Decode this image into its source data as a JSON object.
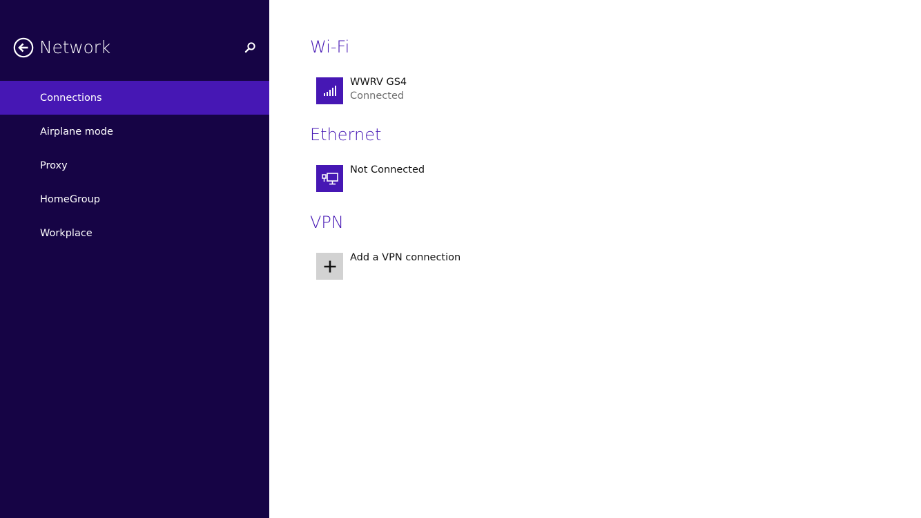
{
  "sidebar": {
    "title": "Network",
    "back_icon": "back-arrow-circle-icon",
    "search_icon": "search-icon",
    "items": [
      {
        "label": "Connections",
        "active": true
      },
      {
        "label": "Airplane mode",
        "active": false
      },
      {
        "label": "Proxy",
        "active": false
      },
      {
        "label": "HomeGroup",
        "active": false
      },
      {
        "label": "Workplace",
        "active": false
      }
    ]
  },
  "main": {
    "wifi": {
      "title": "Wi-Fi",
      "network": {
        "name": "WWRV GS4",
        "status": "Connected",
        "icon": "wifi-signal-icon"
      }
    },
    "ethernet": {
      "title": "Ethernet",
      "network": {
        "name": "Not Connected",
        "icon": "ethernet-icon"
      }
    },
    "vpn": {
      "title": "VPN",
      "add": {
        "label": "Add a VPN connection",
        "icon": "plus-icon"
      }
    }
  },
  "colors": {
    "sidebar_background": "#160445",
    "accent": "#4617b4",
    "add_tile": "#d2d2d2"
  }
}
